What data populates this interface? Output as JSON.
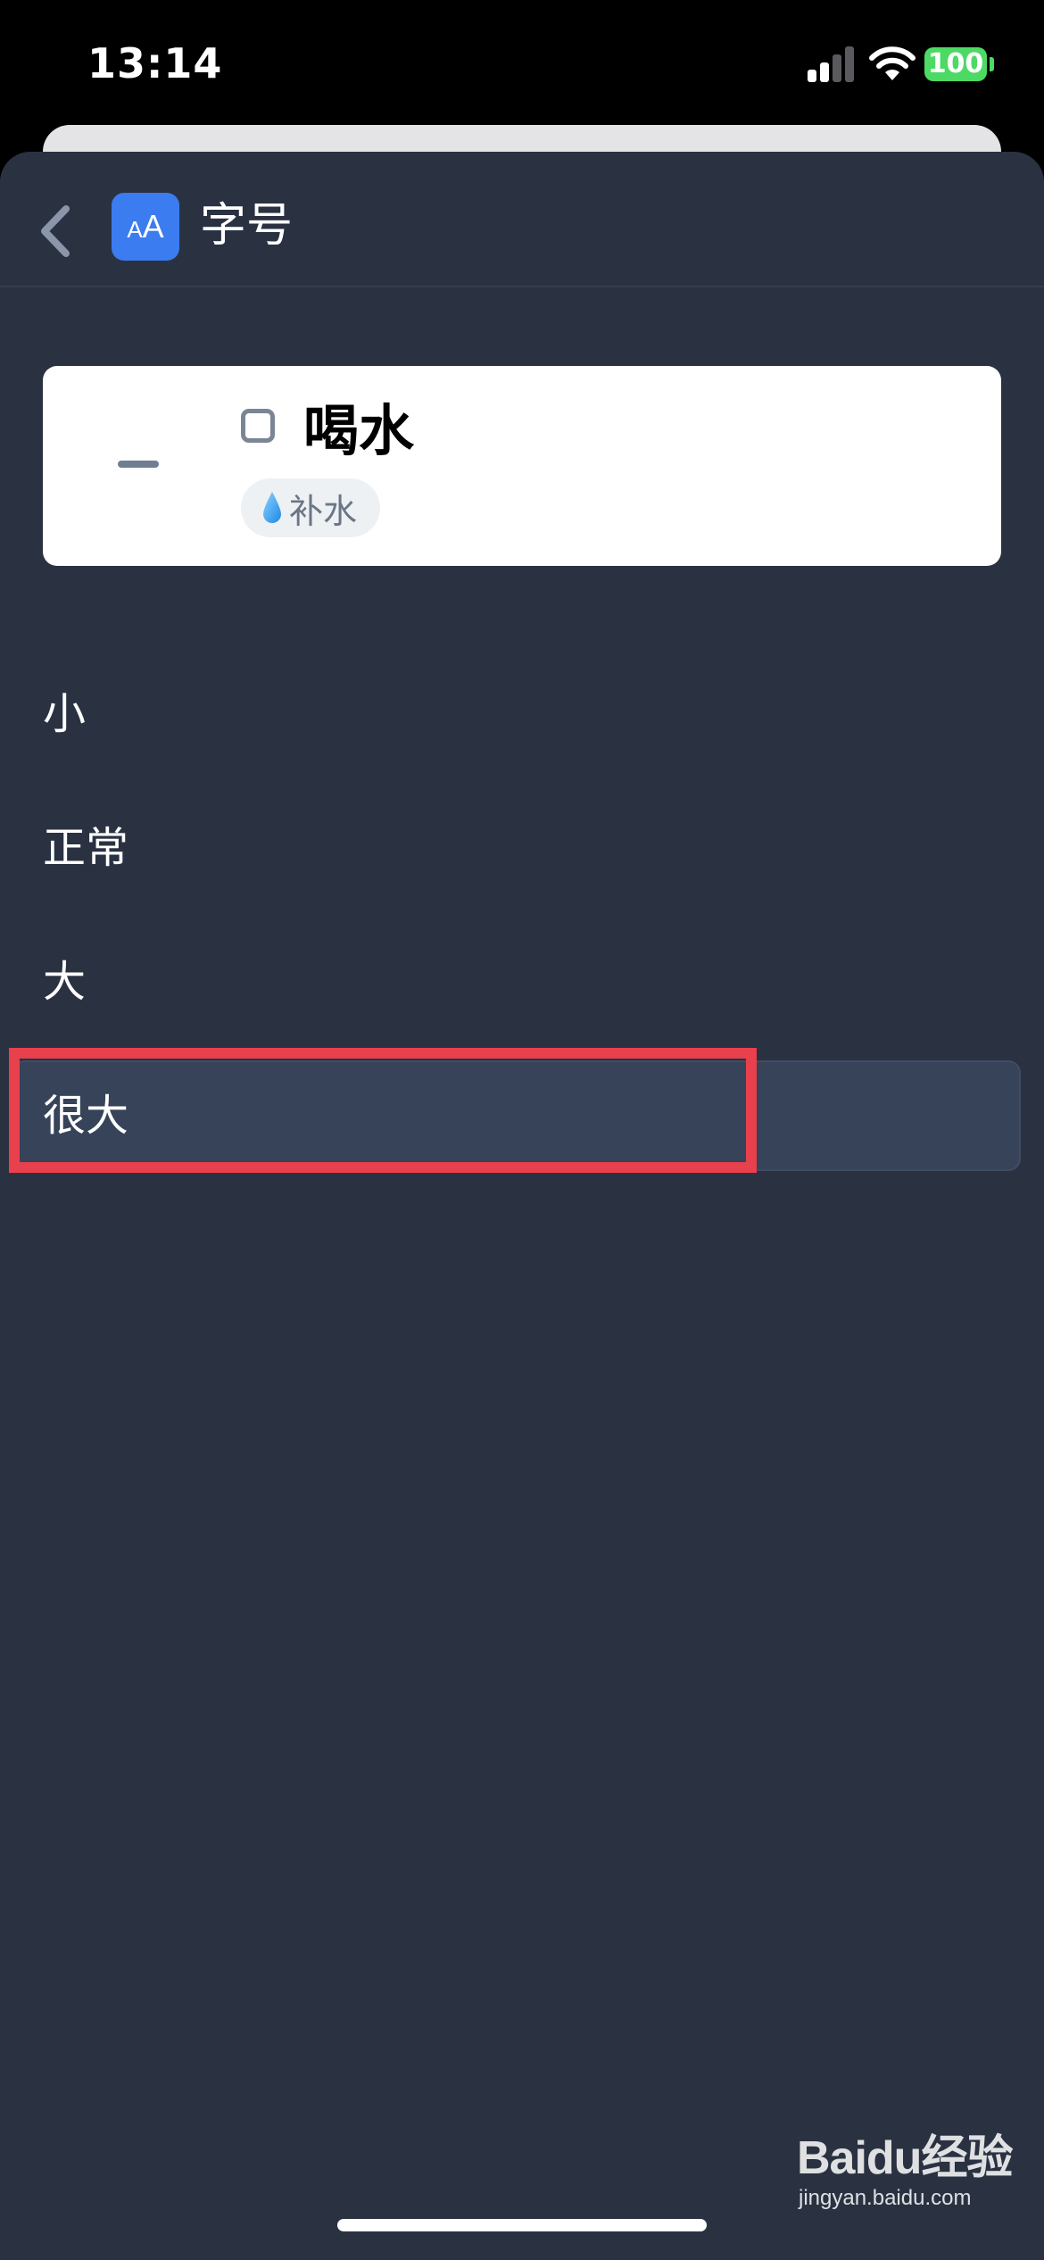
{
  "status_bar": {
    "time": "13:14",
    "battery": "100",
    "icons": [
      "signal-icon",
      "wifi-icon",
      "battery-icon"
    ],
    "battery_color": "#4cd964"
  },
  "header": {
    "title": "字号",
    "icon_text_small": "A",
    "icon_text_big": "A",
    "icons": [
      "back-chevron-icon",
      "font-size-icon"
    ],
    "accent": "#3b7cf0"
  },
  "preview": {
    "task_title": "喝水",
    "tag_emoji": "💧",
    "tag_label": "补水"
  },
  "options": [
    {
      "label": "小"
    },
    {
      "label": "正常"
    },
    {
      "label": "大"
    },
    {
      "label": "很大",
      "selected": true
    }
  ],
  "highlight_color": "#e8404c",
  "watermark": {
    "logo": "Baidu经验",
    "url": "jingyan.baidu.com"
  }
}
